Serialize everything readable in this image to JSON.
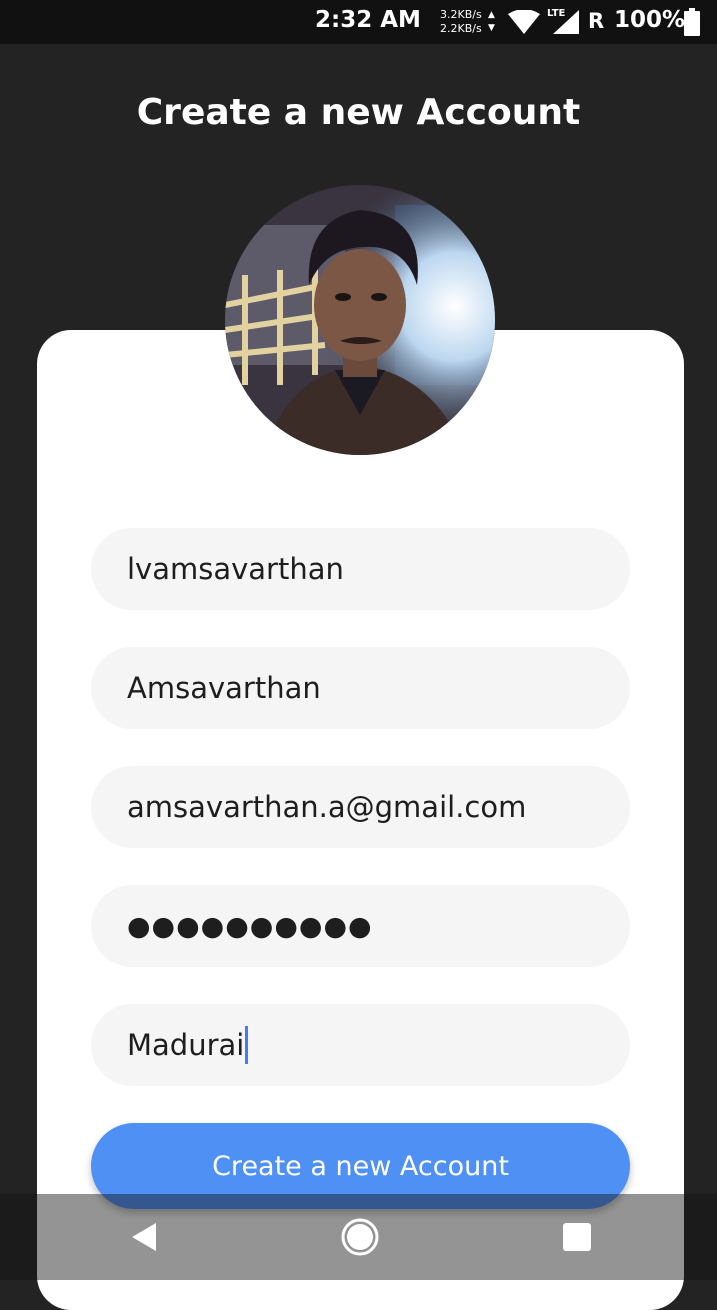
{
  "status_bar": {
    "time": "2:32 AM",
    "upload_speed": "3.2KB/s",
    "download_speed": "2.2KB/s",
    "network": "LTE",
    "roaming": "R",
    "battery": "100%"
  },
  "header": {
    "title": "Create a new Account"
  },
  "form": {
    "username": "lvamsavarthan",
    "full_name": "Amsavarthan",
    "email": "amsavarthan.a@gmail.com",
    "password_mask": "●●●●●●●●●●",
    "location": "Madurai",
    "submit_label": "Create a new Account"
  },
  "colors": {
    "background": "#232323",
    "card": "#ffffff",
    "field_bg": "#f5f5f5",
    "accent": "#4f90f5"
  },
  "icons": {
    "avatar": "profile-photo",
    "nav": [
      "back-icon",
      "home-icon",
      "recents-icon"
    ]
  }
}
